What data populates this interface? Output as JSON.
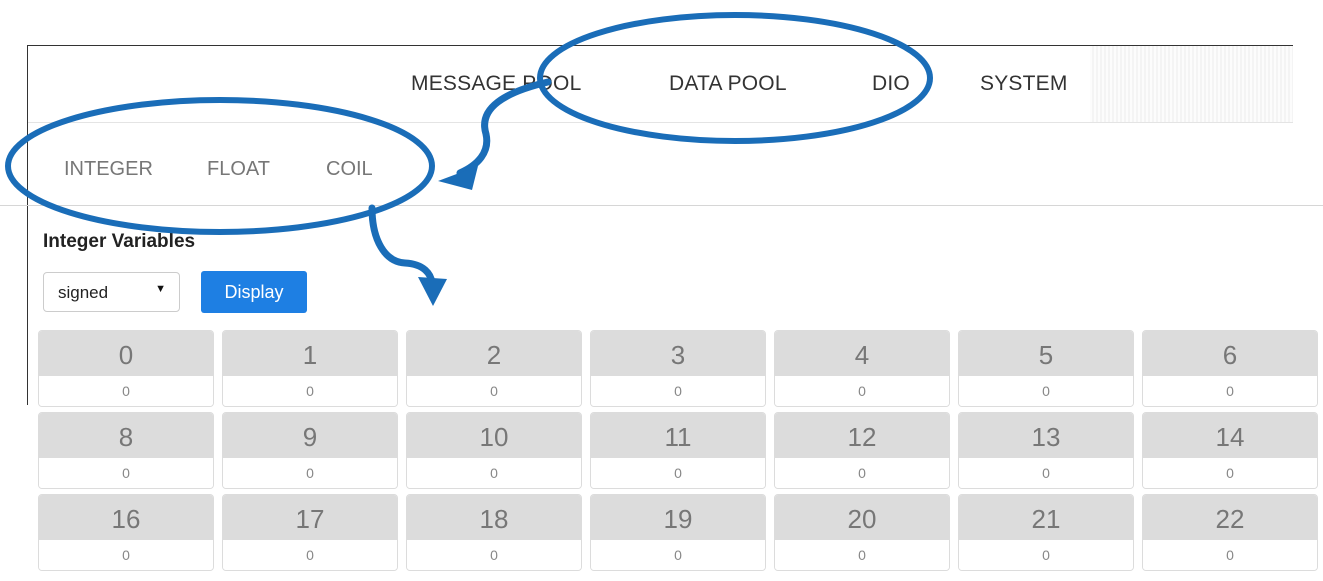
{
  "topnav": {
    "items": [
      {
        "label": "MESSAGE POOL"
      },
      {
        "label": "DATA POOL"
      },
      {
        "label": "DIO"
      },
      {
        "label": "SYSTEM"
      }
    ]
  },
  "subnav": {
    "items": [
      {
        "label": "INTEGER"
      },
      {
        "label": "FLOAT"
      },
      {
        "label": "COIL"
      }
    ]
  },
  "section": {
    "title": "Integer Variables"
  },
  "controls": {
    "type_select": {
      "selected": "signed"
    },
    "display_label": "Display"
  },
  "variables": [
    [
      {
        "index": "0",
        "value": "0"
      },
      {
        "index": "1",
        "value": "0"
      },
      {
        "index": "2",
        "value": "0"
      },
      {
        "index": "3",
        "value": "0"
      },
      {
        "index": "4",
        "value": "0"
      },
      {
        "index": "5",
        "value": "0"
      },
      {
        "index": "6",
        "value": "0"
      }
    ],
    [
      {
        "index": "8",
        "value": "0"
      },
      {
        "index": "9",
        "value": "0"
      },
      {
        "index": "10",
        "value": "0"
      },
      {
        "index": "11",
        "value": "0"
      },
      {
        "index": "12",
        "value": "0"
      },
      {
        "index": "13",
        "value": "0"
      },
      {
        "index": "14",
        "value": "0"
      }
    ],
    [
      {
        "index": "16",
        "value": "0"
      },
      {
        "index": "17",
        "value": "0"
      },
      {
        "index": "18",
        "value": "0"
      },
      {
        "index": "19",
        "value": "0"
      },
      {
        "index": "20",
        "value": "0"
      },
      {
        "index": "21",
        "value": "0"
      },
      {
        "index": "22",
        "value": "0"
      }
    ]
  ],
  "colors": {
    "accent": "#1e7fe3",
    "annotation": "#1a6db8",
    "cell_header": "#dcdcdc"
  }
}
